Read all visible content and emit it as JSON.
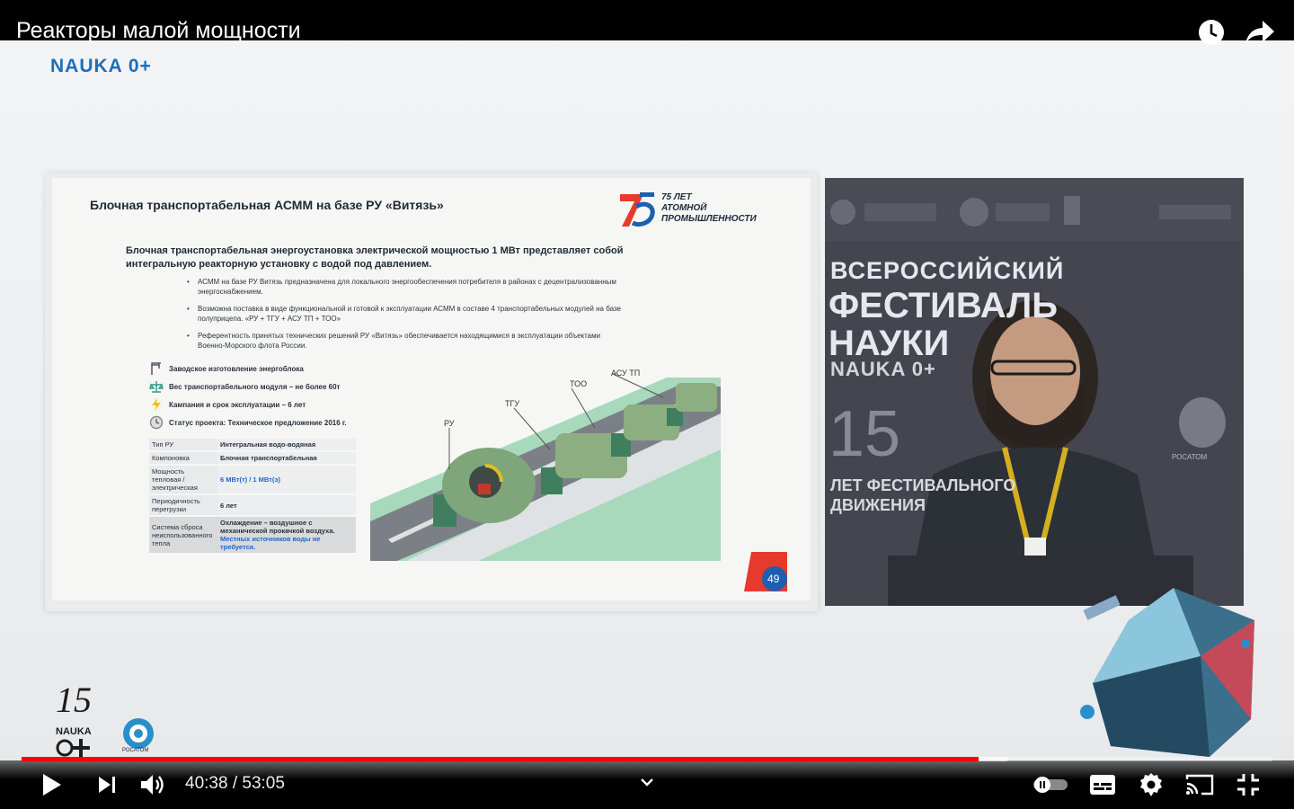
{
  "video": {
    "title": "Реакторы малой мощности",
    "watermark_top": "NAUKA 0+",
    "progress_fraction": 0.765,
    "buffer_fraction": 0.788
  },
  "slide": {
    "title": "Блочная транспортабельная АСММ на базе РУ «Витязь»",
    "anniversary": [
      "75 ЛЕТ",
      "АТОМНОЙ",
      "ПРОМЫШЛЕННОСТИ"
    ],
    "lead": "Блочная транспортабельная энергоустановка электрической мощностью 1 МВт представляет собой интегральную реакторную установку с водой под давлением.",
    "bullets": [
      "АСММ на базе РУ Витязь предназначена для локального энергообеспечения потребителя в районах с децентрализованным энергоснабжением.",
      "Возможна поставка в виде функциональной и готовой к эксплуатации АСММ в составе 4 транспортабельных модулей на базе полуприцепа. «РУ + ТГУ + АСУ ТП + ТОО»",
      "Референтность принятых технических решений РУ «Витязь» обеспечивается находящимися в эксплуатации объектами Военно-Морского флота России."
    ],
    "features": [
      "Заводское изготовление энергоблока",
      "Вес транспортабельного модуля – не более 60т",
      "Кампания и срок эксплуатации – 6 лет",
      "Статус проекта: Техническое предложение 2016 г."
    ],
    "table": [
      {
        "k": "Тип РУ",
        "v": "Интегральная водо-водяная"
      },
      {
        "k": "Компоновка",
        "v": "Блочная транспортабельная"
      },
      {
        "k": "Мощность тепловая / электрическая",
        "v": "6 МВт(т) / 1 МВт(э)"
      },
      {
        "k": "Периодичность перегрузки",
        "v": "6 лет"
      },
      {
        "k": "Система сброса неиспользованного тепла",
        "v": "Охлаждение – воздушное с механической прокачкой воздуха.",
        "v2": "Местных источников воды не требуется."
      }
    ],
    "modules": [
      "РУ",
      "ТГУ",
      "ТОО",
      "АСУ ТП"
    ],
    "page_number": "49"
  },
  "speaker_panel": {
    "lines": [
      "ВСЕРОССИЙСКИЙ",
      "ФЕСТИВАЛЬ",
      "НАУКИ",
      "NAUKA 0+",
      "15",
      "ЛЕТ ФЕСТИВАЛЬНОГО",
      "ДВИЖЕНИЯ"
    ],
    "rosatom": "РОСАТОМ"
  },
  "bottom_logos": {
    "nauka": "NAUKA",
    "rosatom": "РОСАТОМ"
  },
  "controls": {
    "time": "40:38 / 53:05"
  },
  "colors": {
    "progress": "#ff0000",
    "brand_blue": "#1c6fb8"
  }
}
